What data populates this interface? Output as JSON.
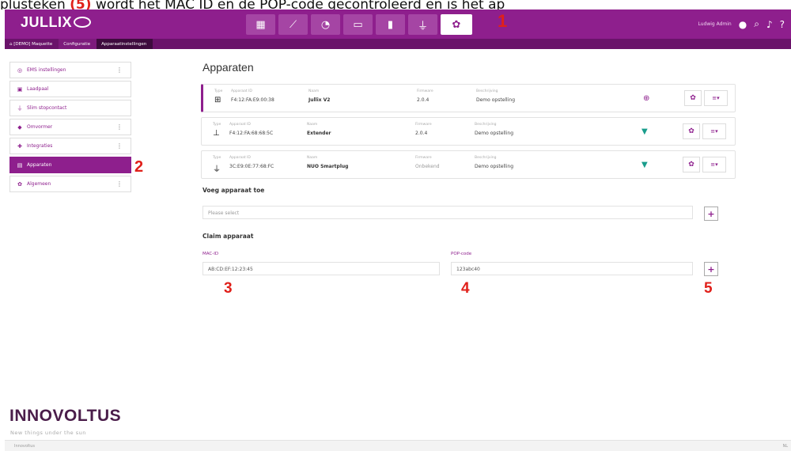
{
  "caption": {
    "before": "plusteken ",
    "highlight": "(5)",
    "after": " wordt het MAC ID en de POP-code gecontroleerd en is het ap"
  },
  "header": {
    "logo": "JULLIX",
    "nav": [
      "dashboard-icon",
      "chart-icon",
      "gauge-icon",
      "battery-icon",
      "meter-icon",
      "plug-icon",
      "settings-icon"
    ],
    "active_nav": "settings-icon",
    "user": "Ludwig Admin",
    "marker": "1"
  },
  "breadcrumb": [
    "[DEMO] Maquette",
    "Configuratie",
    "Apparaatinstellingen"
  ],
  "sidebar": {
    "items": [
      {
        "label": "EMS instellingen",
        "icon": "ems-icon",
        "kebab": true,
        "active": false
      },
      {
        "label": "Laadpaal",
        "icon": "charger-icon",
        "kebab": false,
        "active": false
      },
      {
        "label": "Slim stopcontact",
        "icon": "plug-icon",
        "kebab": false,
        "active": false
      },
      {
        "label": "Omvormer",
        "icon": "inverter-icon",
        "kebab": true,
        "active": false
      },
      {
        "label": "Integraties",
        "icon": "puzzle-icon",
        "kebab": true,
        "active": false
      },
      {
        "label": "Apparaten",
        "icon": "devices-icon",
        "kebab": false,
        "active": true
      },
      {
        "label": "Algemeen",
        "icon": "gear-icon",
        "kebab": true,
        "active": false
      }
    ],
    "marker": "2"
  },
  "main": {
    "title": "Apparaten",
    "columns": {
      "type": "Type",
      "id": "Apparaat ID",
      "name": "Naam",
      "firmware": "Firmware",
      "desc": "Beschrijving"
    },
    "devices": [
      {
        "id": "F4:12:FA:E9:00:38",
        "name": "Jullix V2",
        "firmware": "2.0.4",
        "desc": "Demo opstelling",
        "status": "globe"
      },
      {
        "id": "F4:12:FA:68:68:5C",
        "name": "Extender",
        "firmware": "2.0.4",
        "desc": "Demo opstelling",
        "status": "wifi"
      },
      {
        "id": "3C:E9:0E:77:68:FC",
        "name": "NUO Smartplug",
        "firmware": "Onbekend",
        "desc": "Demo opstelling",
        "status": "wifi"
      }
    ],
    "add_section": {
      "title": "Voeg apparaat toe",
      "placeholder": "Please select"
    },
    "claim_section": {
      "title": "Claim apparaat",
      "mac_label": "MAC-ID",
      "mac_value": "AB:CD:EF:12:23:45",
      "pop_label": "POP-code",
      "pop_value": "123abc40"
    },
    "markers": [
      "3",
      "4",
      "5"
    ]
  },
  "brand": {
    "name": "INNOVOLTUS",
    "tagline": "New things under the sun"
  },
  "footer": {
    "left": "Innovoltus",
    "right": "NL"
  },
  "colors": {
    "primary": "#8e1f8d",
    "marker": "#e0201a",
    "status_green": "#1a9d8c"
  }
}
